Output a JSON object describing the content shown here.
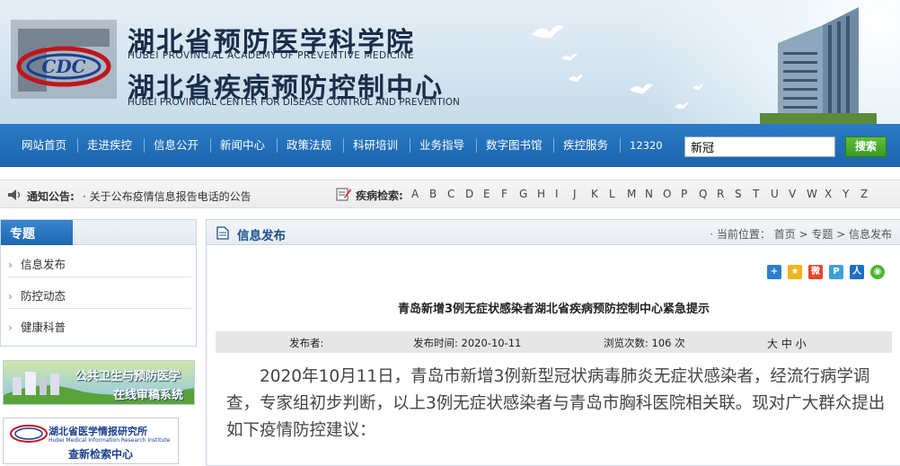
{
  "header": {
    "title_cn_1": "湖北省预防医学科学院",
    "title_en_1": "HUBEI PROVINCIAL ACADEMY OF PREVENTIVE MEDICINE",
    "title_cn_2": "湖北省疾病预防控制中心",
    "title_en_2": "HUBEI PROVINCIAL CENTER FOR DISEASE CONTROL AND PREVENTION",
    "logo_text": "CDC"
  },
  "nav": {
    "items": [
      "网站首页",
      "走进疾控",
      "信息公开",
      "新闻中心",
      "政策法规",
      "科研培训",
      "业务指导",
      "数字图书馆",
      "疾控服务",
      "12320"
    ],
    "search_value": "新冠",
    "search_button": "搜索"
  },
  "notice": {
    "label": "通知公告:",
    "text": "· 关于公布疫情信息报告电话的公告",
    "disease_label": "疾病检索:",
    "letters": [
      "A",
      "B",
      "C",
      "D",
      "E",
      "F",
      "G",
      "H",
      "I",
      "J",
      "K",
      "L",
      "M",
      "N",
      "O",
      "P",
      "Q",
      "R",
      "S",
      "T",
      "U",
      "V",
      "W",
      "X",
      "Y",
      "Z"
    ]
  },
  "sidebar": {
    "title": "专题",
    "items": [
      "信息发布",
      "防控动态",
      "健康科普"
    ],
    "ad1_text_1": "公共卫生与预防医学",
    "ad1_text_2": "在线审稿系统",
    "ad2_text_1": "湖北省医学情报研究所",
    "ad2_text_2": "Hubei Medical Information Research Institute",
    "ad2_text_3": "查新检索中心"
  },
  "main": {
    "section_title": "信息发布",
    "breadcrumb": "· 当前位置： 首页 > 专题 > 信息发布",
    "share_icons": [
      "plus-share-icon",
      "qzone-icon",
      "weibo-icon",
      "tencent-weibo-icon",
      "renren-icon",
      "wechat-icon"
    ],
    "article_title": "青岛新增3例无症状感染者湖北省疾病预防控制中心紧急提示",
    "meta": {
      "publisher_label": "发布者:",
      "time_label": "发布时间: 2020-10-11",
      "views_label": "浏览次数: 106 次",
      "font_size": "大 中 小"
    },
    "body": "2020年10月11日，青岛市新增3例新型冠状病毒肺炎无症状感染者，经流行病学调查，专家组初步判断，以上3例无症状感染者与青岛市胸科医院相关联。现对广大群众提出如下疫情防控建议："
  },
  "colors": {
    "nav_blue": "#1c64ad",
    "title_navy": "#1a2d4a",
    "search_green": "#3b9a1f",
    "section_blue": "#1d4f8a"
  }
}
